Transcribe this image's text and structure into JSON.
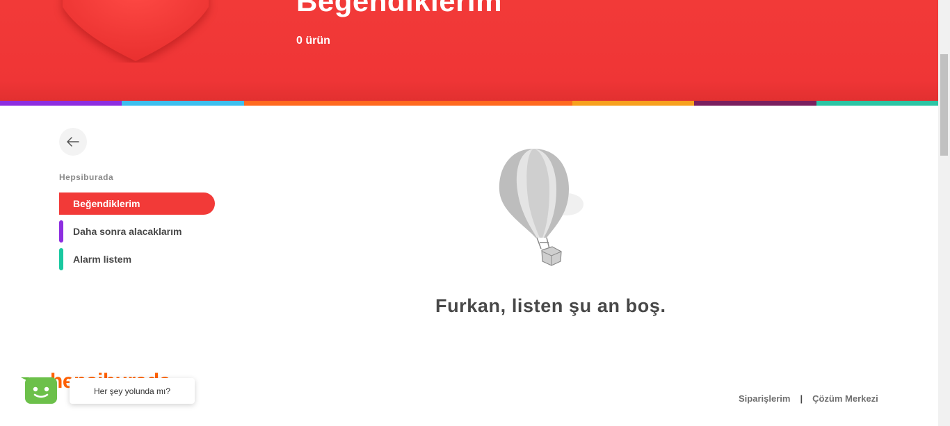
{
  "header": {
    "title": "Beğendiklerim",
    "count_label": "0 ürün",
    "strip_colors": [
      "#8d2ee0",
      "#3dbfee",
      "#ff6a1f",
      "#ff6a1f",
      "#f7a11d",
      "#7a1f5f",
      "#2bc5a4"
    ]
  },
  "sidebar": {
    "back_icon": "arrow-left-icon",
    "heading": "Hepsiburada",
    "items": [
      {
        "label": "Beğendiklerim",
        "active": true,
        "color": "#f23a38"
      },
      {
        "label": "Daha sonra alacaklarım",
        "active": false,
        "color": "#8d2ee0"
      },
      {
        "label": "Alarm listem",
        "active": false,
        "color": "#19c8a0"
      }
    ]
  },
  "empty_state": {
    "icon": "hot-air-balloon-icon",
    "message": "Furkan, listen şu an boş."
  },
  "footer": {
    "logo_text": "hepsiburada",
    "links": [
      "Siparişlerim",
      "Çözüm Merkezi"
    ],
    "separator": "|"
  },
  "chat": {
    "avatar_icon": "smiley-bot-icon",
    "bubble_text": "Her şey yolunda mı?"
  },
  "colors": {
    "brand_red": "#f23a38",
    "brand_orange": "#ff6000"
  }
}
